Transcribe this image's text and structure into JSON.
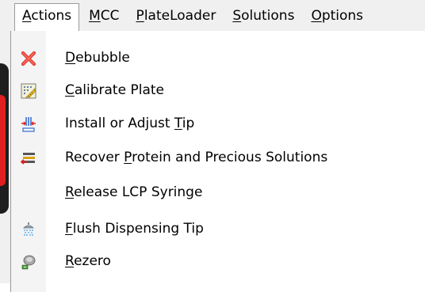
{
  "menubar": {
    "items": [
      {
        "pre": "",
        "key": "A",
        "post": "ctions",
        "open": true
      },
      {
        "pre": "",
        "key": "M",
        "post": "CC",
        "open": false
      },
      {
        "pre": "",
        "key": "P",
        "post": "lateLoader",
        "open": false
      },
      {
        "pre": "",
        "key": "S",
        "post": "olutions",
        "open": false
      },
      {
        "pre": "",
        "key": "O",
        "post": "ptions",
        "open": false
      }
    ]
  },
  "actions_menu": {
    "items": [
      {
        "pre": "",
        "key": "D",
        "post": "ebubble",
        "icon": "red-x-icon"
      },
      {
        "pre": "",
        "key": "C",
        "post": "alibrate Plate",
        "icon": "ruler-grid-icon"
      },
      {
        "pre": "Install or Adjust ",
        "key": "T",
        "post": "ip",
        "icon": "tip-adjust-icon"
      },
      {
        "pre": "Recover ",
        "key": "P",
        "post": "rotein and Precious Solutions",
        "icon": "recover-icon"
      },
      {
        "pre": "",
        "key": "R",
        "post": "elease LCP Syringe",
        "icon": ""
      },
      {
        "pre": "",
        "key": "F",
        "post": "lush Dispensing Tip",
        "icon": "shower-icon"
      },
      {
        "pre": "",
        "key": "R",
        "post": "ezero",
        "icon": "rezero-icon"
      }
    ]
  },
  "colors": {
    "menubar_bg": "#f0f0f0",
    "menu_border": "#9a9a9a",
    "icon_red": "#e02020"
  }
}
